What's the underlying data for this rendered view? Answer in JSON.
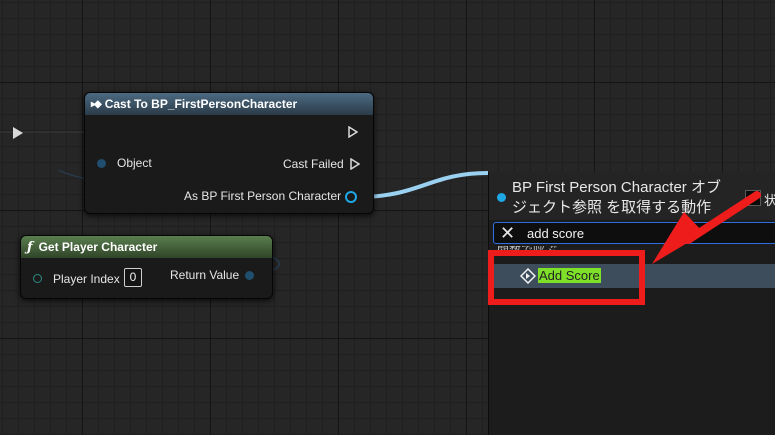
{
  "cast_node": {
    "title": "Cast To BP_FirstPersonCharacter",
    "object_pin": "Object",
    "cast_failed_pin": "Cast Failed",
    "as_pin": "As BP First Person Character"
  },
  "get_node": {
    "title": "Get Player Character",
    "player_index_pin": "Player Index",
    "player_index_value": "0",
    "return_value_pin": "Return Value"
  },
  "context_menu": {
    "title": "BP First Person Character オブジェクト参照 を取得する動作",
    "context_label": "状",
    "search_value": "add score",
    "category": "関数で呼ぶ",
    "result": "Add Score"
  },
  "colors": {
    "object_pin": "#1fa7e6",
    "wire": "#9ad0f0",
    "highlight": "#ef1c1c",
    "search_match": "#7ee028"
  }
}
